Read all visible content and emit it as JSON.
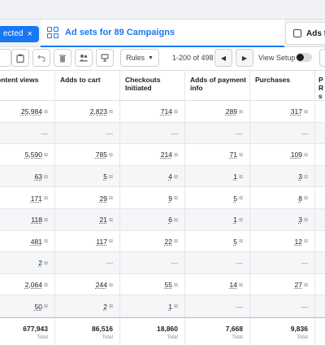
{
  "selected_chip": {
    "label": "ected",
    "close": "×"
  },
  "tabs": {
    "active_label": "Ad sets for 89 Campaigns",
    "right_label": "Ads f"
  },
  "toolbar": {
    "rules_label": "Rules",
    "pager_text": "1-200 of 498",
    "prev": "◀",
    "next": "▶",
    "view_setup": "View Setup"
  },
  "columns": [
    "ontent views",
    "Adds to cart",
    "Checkouts Initiated",
    "Adds of payment info",
    "Purchases",
    "P R s"
  ],
  "rows": [
    [
      "25,984",
      "2,823",
      "714",
      "289",
      "317"
    ],
    [
      "—",
      "—",
      "—",
      "—",
      "—"
    ],
    [
      "5,590",
      "785",
      "214",
      "71",
      "109"
    ],
    [
      "63",
      "5",
      "4",
      "1",
      "3"
    ],
    [
      "171",
      "29",
      "9",
      "5",
      "8"
    ],
    [
      "118",
      "21",
      "6",
      "1",
      "3"
    ],
    [
      "481",
      "117",
      "22",
      "5",
      "12"
    ],
    [
      "2",
      "—",
      "—",
      "—",
      "—"
    ],
    [
      "2,064",
      "244",
      "55",
      "14",
      "27"
    ],
    [
      "50",
      "2",
      "1",
      "—",
      "—"
    ]
  ],
  "totals": {
    "values": [
      "677,943",
      "86,516",
      "18,860",
      "7,668",
      "9,836"
    ],
    "label": "Total"
  }
}
